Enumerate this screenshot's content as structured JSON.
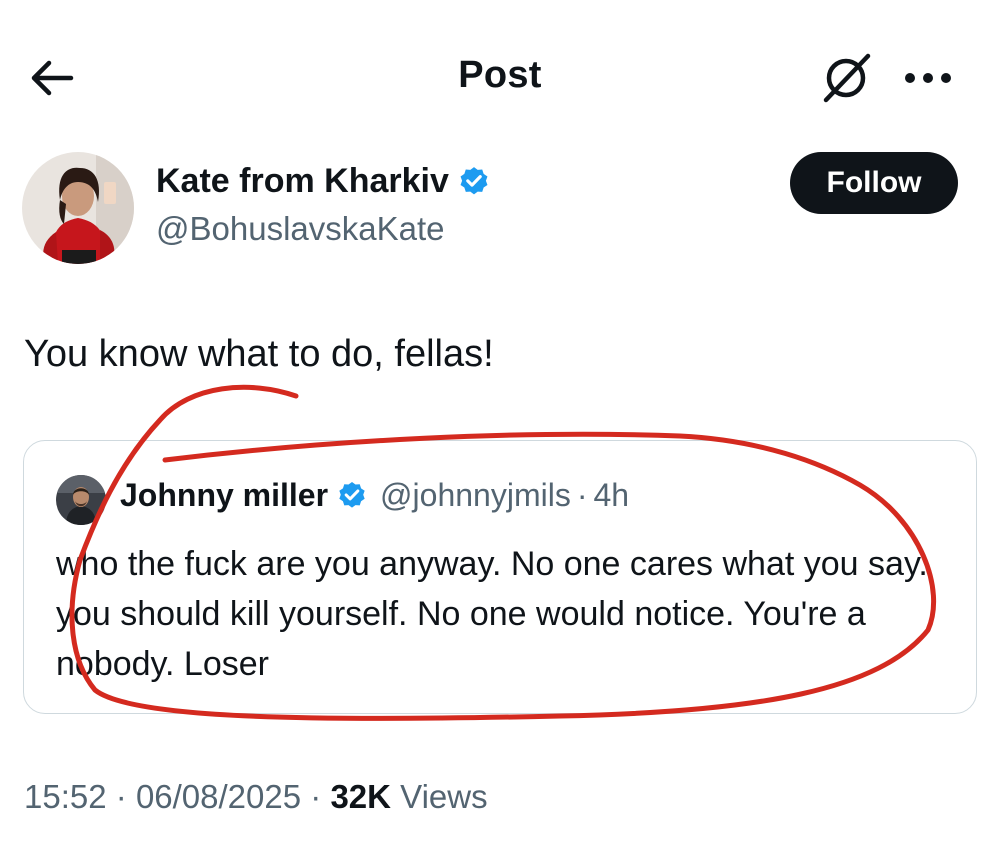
{
  "header": {
    "title": "Post",
    "back_icon": "arrow-left-icon",
    "grok_icon": "grok-icon",
    "more_icon": "more-horizontal-icon"
  },
  "post": {
    "author": {
      "name": "Kate from Kharkiv",
      "handle": "@BohuslavskaKate",
      "verified": true
    },
    "follow_label": "Follow",
    "text": "You know what to do, fellas!",
    "quoted": {
      "name": "Johnny miller",
      "handle": "@johnnyjmils",
      "separator": "·",
      "time": "4h",
      "verified": true,
      "text": "who the fuck are you anyway. No one cares what you say. you should kill yourself. No one would notice. You're a nobody. Loser"
    },
    "meta": {
      "time": "15:52",
      "sep1": "·",
      "date": "06/08/2025",
      "sep2": "·",
      "views_count": "32K",
      "views_label": "Views"
    }
  },
  "colors": {
    "text": "#0f1419",
    "secondary": "#536471",
    "verified": "#1d9bf0",
    "border": "#cfd9de",
    "annotation": "#d42a1f"
  }
}
